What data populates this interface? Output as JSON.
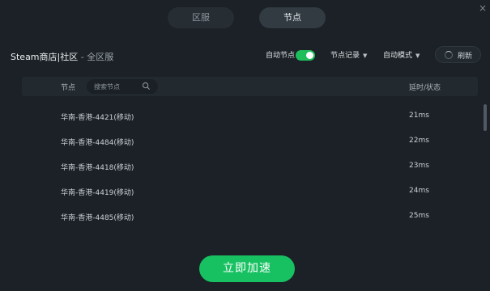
{
  "window": {
    "close_glyph": "×"
  },
  "tabs": [
    {
      "label": "区服",
      "active": false
    },
    {
      "label": "节点",
      "active": true
    }
  ],
  "header": {
    "game": "Steam商店|社区",
    "separator": " - ",
    "region": "全区服"
  },
  "controls": {
    "auto_node_label": "自动节点",
    "auto_node_on": true,
    "node_history_label": "节点记录",
    "auto_mode_label": "自动模式",
    "dropdown_arrow": "▼",
    "refresh_label": "刷新"
  },
  "list": {
    "col_node": "节点",
    "search_placeholder": "搜索节点",
    "col_latency": "延时/状态",
    "rows": [
      {
        "name": "华南-香港-4421(移动)",
        "latency": "21ms"
      },
      {
        "name": "华南-香港-4484(移动)",
        "latency": "22ms"
      },
      {
        "name": "华南-香港-4418(移动)",
        "latency": "23ms"
      },
      {
        "name": "华南-香港-4419(移动)",
        "latency": "24ms"
      },
      {
        "name": "华南-香港-4485(移动)",
        "latency": "25ms"
      }
    ]
  },
  "cta": {
    "label": "立即加速"
  },
  "colors": {
    "accent": "#17c162",
    "background": "#1b2126"
  }
}
